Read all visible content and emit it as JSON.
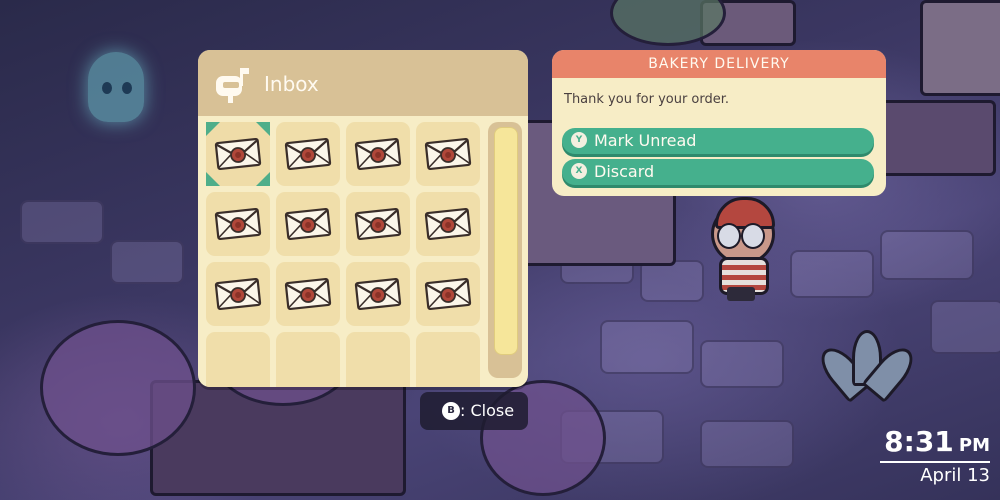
{
  "inbox": {
    "title": "Inbox",
    "icon": "mailbox-icon",
    "slots": [
      {
        "item": "letter-icon",
        "selected": true
      },
      {
        "item": "letter-icon"
      },
      {
        "item": "letter-icon"
      },
      {
        "item": "letter-icon"
      },
      {
        "item": "letter-icon"
      },
      {
        "item": "letter-icon"
      },
      {
        "item": "letter-icon"
      },
      {
        "item": "letter-icon"
      },
      {
        "item": "letter-icon"
      },
      {
        "item": "letter-icon"
      },
      {
        "item": "letter-icon"
      },
      {
        "item": "letter-icon"
      },
      {
        "item": null
      },
      {
        "item": null
      },
      {
        "item": null
      },
      {
        "item": null
      }
    ]
  },
  "close_hint": {
    "button": "B",
    "label": ": Close"
  },
  "detail": {
    "title": "BAKERY DELIVERY",
    "message": "Thank you for your order.",
    "actions": [
      {
        "button": "Y",
        "label": "Mark Unread"
      },
      {
        "button": "X",
        "label": "Discard"
      }
    ]
  },
  "clock": {
    "time": "8:31",
    "ampm": "PM",
    "date": "April 13"
  },
  "colors": {
    "accent": "#45b08d",
    "header": "#e8846a",
    "panel": "#f7edc6",
    "panel_header": "#d8c196"
  }
}
